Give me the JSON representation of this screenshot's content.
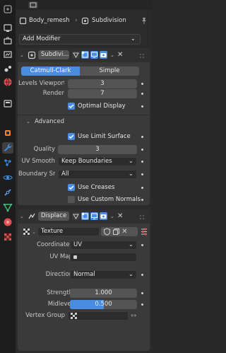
{
  "tabs": [
    {
      "name": "tool-icon",
      "color": "#9a9a9a",
      "active": false
    },
    {
      "name": "render-icon",
      "color": "#d0d0d0",
      "active": false
    },
    {
      "name": "output-icon",
      "color": "#d0d0d0",
      "active": false
    },
    {
      "name": "view-layer-icon",
      "color": "#d0d0d0",
      "active": false
    },
    {
      "name": "scene-icon",
      "color": "#d0d0d0",
      "active": false
    },
    {
      "name": "world-icon",
      "color": "#e05050",
      "active": false
    },
    {
      "name": "collection-icon",
      "color": "#d0d0d0",
      "active": false
    },
    {
      "name": "object-icon",
      "color": "#e8853b",
      "active": false
    },
    {
      "name": "modifier-wrench-icon",
      "color": "#3f8fe8",
      "active": true
    },
    {
      "name": "particles-icon",
      "color": "#3f8fe8",
      "active": false
    },
    {
      "name": "physics-icon",
      "color": "#3f8fe8",
      "active": false
    },
    {
      "name": "constraints-icon",
      "color": "#5aa0e8",
      "active": false
    },
    {
      "name": "data-icon",
      "color": "#46c07a",
      "active": false
    },
    {
      "name": "material-icon",
      "color": "#e05050",
      "active": false
    },
    {
      "name": "texture-icon",
      "color": "#e05050",
      "active": false
    }
  ],
  "header": {
    "object_name": "Body_remesh",
    "modifier_name": "Subdivision",
    "pin_icon": "pin-icon"
  },
  "add_modifier": "Add Modifier",
  "subdivision": {
    "name": "Subdivi...",
    "type_options": [
      "Catmull-Clark",
      "Simple"
    ],
    "selected_type": "Catmull-Clark",
    "levels_viewport_label": "Levels Viewport",
    "levels_viewport": "3",
    "render_label": "Render",
    "render": "7",
    "optimal_display_label": "Optimal Display",
    "optimal_display": true,
    "advanced_label": "Advanced",
    "use_limit_surface_label": "Use Limit Surface",
    "use_limit_surface": true,
    "quality_label": "Quality",
    "quality": "3",
    "uv_smooth_label": "UV Smooth",
    "uv_smooth": "Keep Boundaries",
    "boundary_smooth_label": "Boundary Smo...",
    "boundary_smooth": "All",
    "use_creases_label": "Use Creases",
    "use_creases": true,
    "use_custom_normals_label": "Use Custom Normals",
    "use_custom_normals": false
  },
  "displace": {
    "name": "Displace",
    "texture_name": "Texture",
    "coordinates_label": "Coordinates",
    "coordinates": "UV",
    "uv_map_label": "UV Map",
    "uv_map": "",
    "direction_label": "Direction",
    "direction": "Normal",
    "strength_label": "Strength",
    "strength": "1.000",
    "midlevel_label": "Midlevel",
    "midlevel": "0.500",
    "midlevel_fraction": 0.5,
    "vertex_group_label": "Vertex Group",
    "vertex_group": ""
  },
  "colors": {
    "accent": "#4a8ce0",
    "panel": "#3a3a3a",
    "background": "#2b2b2b"
  }
}
